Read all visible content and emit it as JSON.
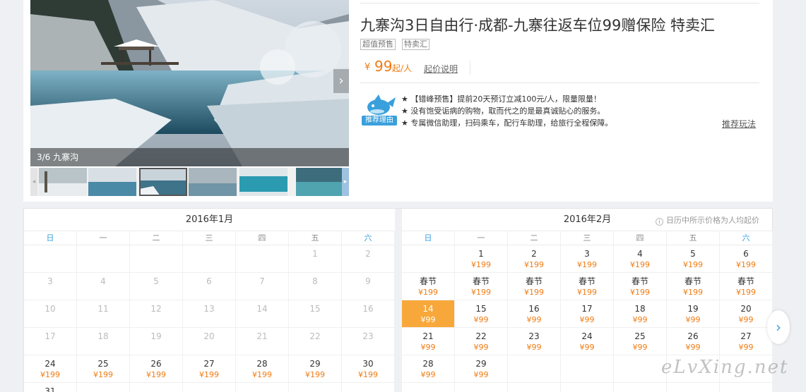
{
  "gallery": {
    "caption": "3/6 九寨沟",
    "next_icon": "›",
    "thumb_prev_icon": "◂",
    "thumb_next_icon": "▸"
  },
  "product": {
    "title": "九寨沟3日自由行·成都-九寨往返车位99赠保险 特卖汇",
    "tags": [
      "超值预售",
      "特卖汇"
    ],
    "price_currency": "¥",
    "price_value": "99",
    "price_unit": "起/人",
    "price_link": "起价说明",
    "reason_label": "推荐理由",
    "reasons": [
      "【错峰预售】提前20天预订立减100元/人，限量限量！",
      "没有饱受诟病的购物，取而代之的是最真诚贴心的服务。",
      "专属微信助理，扫码乘车，配行车助理，给旅行全程保障。"
    ],
    "recommend_link": "推荐玩法"
  },
  "calendar": {
    "note": "日历中所示价格为人均起价",
    "weekdays": [
      "日",
      "一",
      "二",
      "三",
      "四",
      "五",
      "六"
    ],
    "months": [
      {
        "title": "2016年1月",
        "cells": [
          {
            "row": 0,
            "col": 5,
            "day": "1",
            "price": "",
            "state": "past"
          },
          {
            "row": 0,
            "col": 6,
            "day": "2",
            "price": "",
            "state": "past"
          },
          {
            "row": 1,
            "col": 0,
            "day": "3",
            "price": "",
            "state": "past"
          },
          {
            "row": 1,
            "col": 1,
            "day": "4",
            "price": "",
            "state": "past"
          },
          {
            "row": 1,
            "col": 2,
            "day": "5",
            "price": "",
            "state": "past"
          },
          {
            "row": 1,
            "col": 3,
            "day": "6",
            "price": "",
            "state": "past"
          },
          {
            "row": 1,
            "col": 4,
            "day": "7",
            "price": "",
            "state": "past"
          },
          {
            "row": 1,
            "col": 5,
            "day": "8",
            "price": "",
            "state": "past"
          },
          {
            "row": 1,
            "col": 6,
            "day": "9",
            "price": "",
            "state": "past"
          },
          {
            "row": 2,
            "col": 0,
            "day": "10",
            "price": "",
            "state": "past"
          },
          {
            "row": 2,
            "col": 1,
            "day": "11",
            "price": "",
            "state": "past"
          },
          {
            "row": 2,
            "col": 2,
            "day": "12",
            "price": "",
            "state": "past"
          },
          {
            "row": 2,
            "col": 3,
            "day": "13",
            "price": "",
            "state": "past"
          },
          {
            "row": 2,
            "col": 4,
            "day": "14",
            "price": "",
            "state": "past"
          },
          {
            "row": 2,
            "col": 5,
            "day": "15",
            "price": "",
            "state": "past"
          },
          {
            "row": 2,
            "col": 6,
            "day": "16",
            "price": "",
            "state": "past"
          },
          {
            "row": 3,
            "col": 0,
            "day": "17",
            "price": "",
            "state": "past"
          },
          {
            "row": 3,
            "col": 1,
            "day": "18",
            "price": "",
            "state": "past"
          },
          {
            "row": 3,
            "col": 2,
            "day": "19",
            "price": "",
            "state": "past"
          },
          {
            "row": 3,
            "col": 3,
            "day": "20",
            "price": "",
            "state": "past"
          },
          {
            "row": 3,
            "col": 4,
            "day": "21",
            "price": "",
            "state": "past"
          },
          {
            "row": 3,
            "col": 5,
            "day": "22",
            "price": "",
            "state": "past"
          },
          {
            "row": 3,
            "col": 6,
            "day": "23",
            "price": "",
            "state": "past"
          },
          {
            "row": 4,
            "col": 0,
            "day": "24",
            "price": "¥199",
            "state": "avail"
          },
          {
            "row": 4,
            "col": 1,
            "day": "25",
            "price": "¥199",
            "state": "avail"
          },
          {
            "row": 4,
            "col": 2,
            "day": "26",
            "price": "¥199",
            "state": "avail"
          },
          {
            "row": 4,
            "col": 3,
            "day": "27",
            "price": "¥199",
            "state": "avail"
          },
          {
            "row": 4,
            "col": 4,
            "day": "28",
            "price": "¥199",
            "state": "avail"
          },
          {
            "row": 4,
            "col": 5,
            "day": "29",
            "price": "¥199",
            "state": "avail"
          },
          {
            "row": 4,
            "col": 6,
            "day": "30",
            "price": "¥199",
            "state": "avail"
          },
          {
            "row": 5,
            "col": 0,
            "day": "31",
            "price": "",
            "state": "avail"
          }
        ]
      },
      {
        "title": "2016年2月",
        "cells": [
          {
            "row": 0,
            "col": 1,
            "day": "1",
            "price": "¥199",
            "state": "avail"
          },
          {
            "row": 0,
            "col": 2,
            "day": "2",
            "price": "¥199",
            "state": "avail"
          },
          {
            "row": 0,
            "col": 3,
            "day": "3",
            "price": "¥199",
            "state": "avail"
          },
          {
            "row": 0,
            "col": 4,
            "day": "4",
            "price": "¥199",
            "state": "avail"
          },
          {
            "row": 0,
            "col": 5,
            "day": "5",
            "price": "¥199",
            "state": "avail"
          },
          {
            "row": 0,
            "col": 6,
            "day": "6",
            "price": "¥199",
            "state": "avail"
          },
          {
            "row": 1,
            "col": 0,
            "day": "春节",
            "price": "¥199",
            "state": "avail"
          },
          {
            "row": 1,
            "col": 1,
            "day": "春节",
            "price": "¥199",
            "state": "avail"
          },
          {
            "row": 1,
            "col": 2,
            "day": "春节",
            "price": "¥199",
            "state": "avail"
          },
          {
            "row": 1,
            "col": 3,
            "day": "春节",
            "price": "¥199",
            "state": "avail"
          },
          {
            "row": 1,
            "col": 4,
            "day": "春节",
            "price": "¥199",
            "state": "avail"
          },
          {
            "row": 1,
            "col": 5,
            "day": "春节",
            "price": "¥199",
            "state": "avail"
          },
          {
            "row": 1,
            "col": 6,
            "day": "春节",
            "price": "¥199",
            "state": "avail"
          },
          {
            "row": 2,
            "col": 0,
            "day": "14",
            "price": "¥99",
            "state": "selected"
          },
          {
            "row": 2,
            "col": 1,
            "day": "15",
            "price": "¥99",
            "state": "avail"
          },
          {
            "row": 2,
            "col": 2,
            "day": "16",
            "price": "¥99",
            "state": "avail"
          },
          {
            "row": 2,
            "col": 3,
            "day": "17",
            "price": "¥99",
            "state": "avail"
          },
          {
            "row": 2,
            "col": 4,
            "day": "18",
            "price": "¥99",
            "state": "avail"
          },
          {
            "row": 2,
            "col": 5,
            "day": "19",
            "price": "¥99",
            "state": "avail"
          },
          {
            "row": 2,
            "col": 6,
            "day": "20",
            "price": "¥99",
            "state": "avail"
          },
          {
            "row": 3,
            "col": 0,
            "day": "21",
            "price": "¥99",
            "state": "avail"
          },
          {
            "row": 3,
            "col": 1,
            "day": "22",
            "price": "¥99",
            "state": "avail"
          },
          {
            "row": 3,
            "col": 2,
            "day": "23",
            "price": "¥99",
            "state": "avail"
          },
          {
            "row": 3,
            "col": 3,
            "day": "24",
            "price": "¥99",
            "state": "avail"
          },
          {
            "row": 3,
            "col": 4,
            "day": "25",
            "price": "¥99",
            "state": "avail"
          },
          {
            "row": 3,
            "col": 5,
            "day": "26",
            "price": "¥99",
            "state": "avail"
          },
          {
            "row": 3,
            "col": 6,
            "day": "27",
            "price": "¥99",
            "state": "avail"
          },
          {
            "row": 4,
            "col": 0,
            "day": "28",
            "price": "¥99",
            "state": "avail"
          },
          {
            "row": 4,
            "col": 1,
            "day": "29",
            "price": "¥99",
            "state": "avail"
          }
        ]
      }
    ],
    "next_icon": "›"
  },
  "watermark": "eLvXing.net",
  "colors": {
    "accent_orange": "#f07c14",
    "selected_bg": "#f8a83a",
    "weekend_blue": "#3aa0dc"
  }
}
